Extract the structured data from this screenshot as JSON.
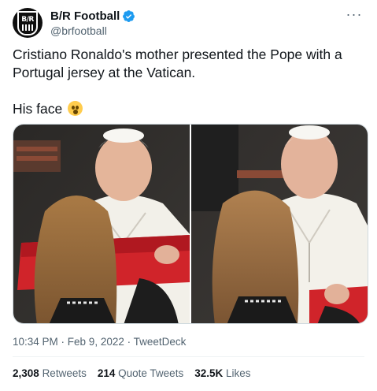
{
  "author": {
    "display_name": "B/R Football",
    "handle": "@brfootball",
    "avatar_text": "B/R",
    "verified_color": "#1d9bf0"
  },
  "tweet": {
    "line1": "Cristiano Ronaldo's mother presented the Pope with a Portugal jersey at the Vatican.",
    "line2": "His face"
  },
  "meta": {
    "time": "10:34 PM",
    "sep1": " · ",
    "date": "Feb 9, 2022",
    "sep2": " · ",
    "source": "TweetDeck"
  },
  "stats": [
    {
      "count": "2,308",
      "label": "Retweets"
    },
    {
      "count": "214",
      "label": "Quote Tweets"
    },
    {
      "count": "32.5K",
      "label": "Likes"
    }
  ],
  "icons": {
    "more": "more-horizontal-icon",
    "verified": "verified-badge-icon",
    "emoji": "hushed-face-emoji"
  }
}
